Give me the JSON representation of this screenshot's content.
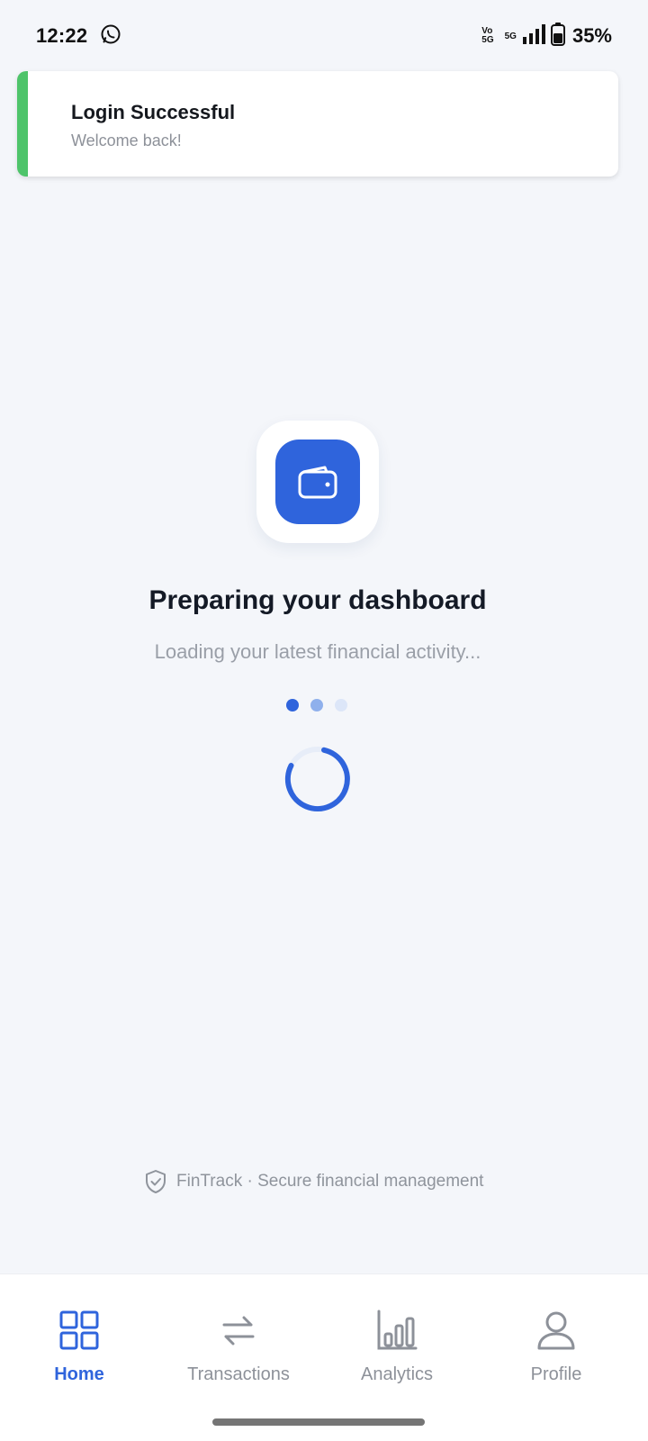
{
  "status_bar": {
    "time": "12:22",
    "volte_top": "Vo",
    "volte_bottom": "5G",
    "network": "5G",
    "battery": "35%"
  },
  "toast": {
    "title": "Login Successful",
    "message": "Welcome back!",
    "accent_color": "#4ec46a"
  },
  "loader": {
    "icon": "wallet-icon",
    "heading": "Preparing your dashboard",
    "subheading": "Loading your latest financial activity..."
  },
  "footer": {
    "icon": "shield-check-icon",
    "text": "FinTrack · Secure financial management"
  },
  "nav": {
    "items": [
      {
        "label": "Home",
        "icon": "grid-icon",
        "active": true
      },
      {
        "label": "Transactions",
        "icon": "swap-arrows-icon",
        "active": false
      },
      {
        "label": "Analytics",
        "icon": "bar-chart-icon",
        "active": false
      },
      {
        "label": "Profile",
        "icon": "user-icon",
        "active": false
      }
    ]
  },
  "colors": {
    "accent": "#2f64dc",
    "background": "#f4f6fa",
    "success": "#4ec46a"
  }
}
